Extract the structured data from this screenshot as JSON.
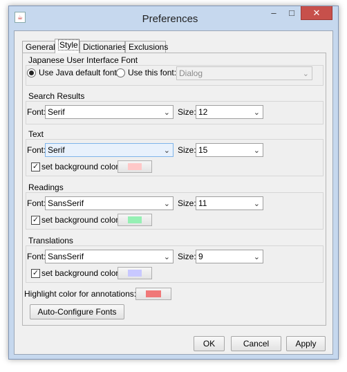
{
  "window": {
    "title": "Preferences",
    "app_icon": "java-icon",
    "min_glyph": "–",
    "max_glyph": "□",
    "close_glyph": "✕"
  },
  "tabs": [
    {
      "label": "General",
      "active": false
    },
    {
      "label": "Style",
      "active": true
    },
    {
      "label": "Dictionaries",
      "active": false
    },
    {
      "label": "Exclusions",
      "active": false
    }
  ],
  "japanese_ui_font": {
    "title": "Japanese User Interface Font",
    "option_default": "Use Java default font",
    "option_custom": "Use this font:",
    "selected": "default",
    "font_value": "Dialog"
  },
  "search_results": {
    "title": "Search Results",
    "font_label": "Font:",
    "font_value": "Serif",
    "size_label": "Size:",
    "size_value": "12"
  },
  "text": {
    "title": "Text",
    "font_label": "Font:",
    "font_value": "Serif",
    "size_label": "Size:",
    "size_value": "15",
    "bg_label": "set background color:",
    "bg_checked": true,
    "bg_color": "#ffc8c8"
  },
  "readings": {
    "title": "Readings",
    "font_label": "Font:",
    "font_value": "SansSerif",
    "size_label": "Size:",
    "size_value": "11",
    "bg_label": "set background color:",
    "bg_checked": true,
    "bg_color": "#96f0b4"
  },
  "translations": {
    "title": "Translations",
    "font_label": "Font:",
    "font_value": "SansSerif",
    "size_label": "Size:",
    "size_value": "9",
    "bg_label": "set background color:",
    "bg_checked": true,
    "bg_color": "#c8c8ff"
  },
  "highlight": {
    "label": "Highlight color for annotations:",
    "color": "#f07878"
  },
  "buttons": {
    "auto_configure": "Auto-Configure Fonts",
    "ok": "OK",
    "cancel": "Cancel",
    "apply": "Apply"
  },
  "glyphs": {
    "dropdown": "⌄",
    "check": "✓"
  }
}
